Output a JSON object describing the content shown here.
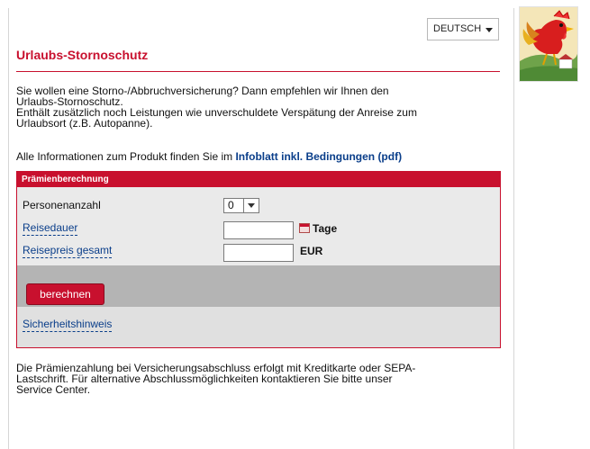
{
  "language": {
    "selected": "DEUTSCH"
  },
  "page": {
    "title": "Urlaubs-Stornoschutz"
  },
  "intro": [
    "Sie wollen eine Storno-/Abbruchversicherung? Dann empfehlen wir Ihnen den",
    "Urlaubs-Stornoschutz.",
    "Enthält zusätzlich noch Leistungen wie unverschuldete Verspätung der Anreise zum",
    "Urlaubsort (z.B. Autopanne)."
  ],
  "info": {
    "text": "Alle Informationen zum Produkt finden Sie im ",
    "link": "Infoblatt inkl. Bedingungen (pdf)"
  },
  "calculator": {
    "heading": "Prämienberechnung",
    "persons_label": "Personenanzahl",
    "persons_value": "0",
    "duration_label": "Reisedauer",
    "duration_value": "",
    "duration_unit": "Tage",
    "price_label": "Reisepreis gesamt",
    "price_value": "",
    "price_unit": "EUR",
    "button": "berechnen",
    "security_link": "Sicherheitshinweis"
  },
  "bottom": [
    "Die Prämienzahlung bei Versicherungsabschluss erfolgt mit Kreditkarte oder SEPA-",
    "Lastschrift. Für alternative Abschlussmöglichkeiten kontaktieren Sie bitte unser",
    "Service Center."
  ],
  "icons": {
    "logo": "rooster-logo-icon",
    "calendar": "calendar-icon",
    "dropdown": "chevron-down-icon"
  },
  "colors": {
    "brand_red": "#c8102e",
    "link_blue": "#0a3e8a",
    "gray_band": "#b4b4b4"
  }
}
